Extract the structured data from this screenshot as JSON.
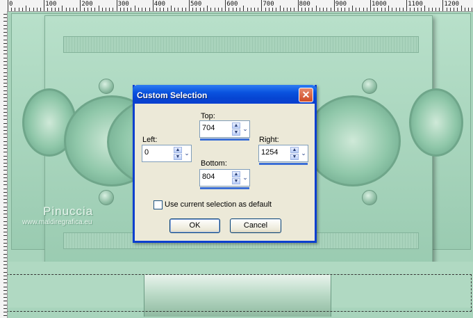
{
  "ruler": {
    "marks": [
      "0",
      "100",
      "200",
      "300",
      "400",
      "500",
      "600",
      "700",
      "800",
      "900",
      "1000",
      "1100",
      "1200"
    ]
  },
  "watermark": {
    "name": "Pinuccia",
    "site": "www.maldiregrafica.eu"
  },
  "dialog": {
    "title": "Custom Selection",
    "top": {
      "label": "Top:",
      "value": "704"
    },
    "left": {
      "label": "Left:",
      "value": "0"
    },
    "right": {
      "label": "Right:",
      "value": "1254"
    },
    "bottom": {
      "label": "Bottom:",
      "value": "804"
    },
    "checkbox_label": "Use current selection as default",
    "checkbox_checked": false,
    "ok_label": "OK",
    "cancel_label": "Cancel",
    "close_glyph": "✕"
  },
  "colors": {
    "titlebar": "#0a53df",
    "dialog_bg": "#ece9d8",
    "canvas": "#a8d4bc"
  }
}
